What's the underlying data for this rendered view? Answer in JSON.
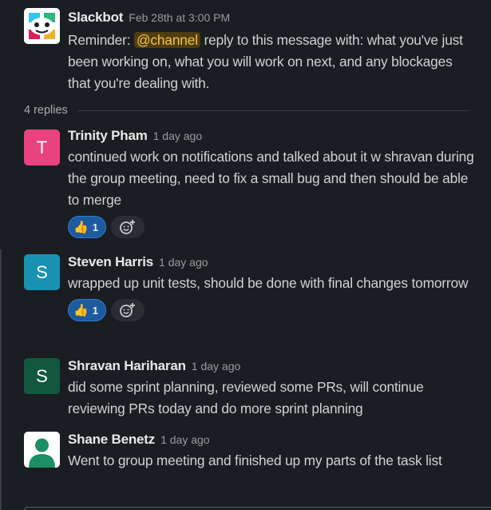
{
  "parent": {
    "author": "Slackbot",
    "time": "Feb 28th at 3:00 PM",
    "prefix": "Reminder: ",
    "mention": "@channel",
    "text": " reply to this message with: what you've just been working on, what you will work on next, and any blockages that you're dealing with."
  },
  "thread": {
    "replies_label": "4 replies"
  },
  "replies": [
    {
      "author": "Trinity Pham",
      "time": "1 day ago",
      "avatar_initial": "T",
      "avatar_color": "#e8437f",
      "text": "continued work on notifications and talked about it w shravan during the group meeting, need to fix a small bug and then should be able to merge",
      "reaction": {
        "emoji": "👍",
        "count": "1"
      }
    },
    {
      "author": "Steven Harris",
      "time": "1 day ago",
      "avatar_initial": "S",
      "avatar_color": "#1a93b2",
      "text": "wrapped up unit tests, should be done with final changes tomorrow",
      "reaction": {
        "emoji": "👍",
        "count": "1"
      }
    },
    {
      "author": "Shravan Hariharan",
      "time": "1 day ago",
      "avatar_initial": "S",
      "avatar_color": "#12583f",
      "text": "did some sprint planning, reviewed some PRs, will continue reviewing PRs today and do more sprint planning"
    },
    {
      "author": "Shane Benetz",
      "time": "1 day ago",
      "avatar_color": "#1b8f63",
      "text": "Went to group meeting and finished up my parts of the task list"
    }
  ],
  "icons": {
    "slackbot": "slackbot-avatar",
    "add_reaction": "add-reaction-icon",
    "default_user": "default-user-avatar"
  }
}
